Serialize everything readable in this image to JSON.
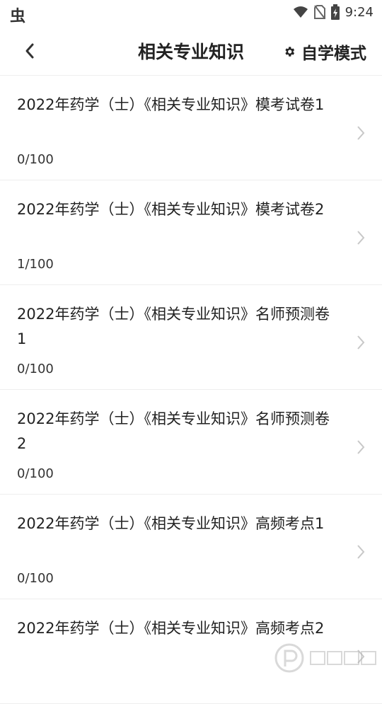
{
  "status_bar": {
    "app_icon": "虫",
    "time": "9:24"
  },
  "header": {
    "back_icon": "chevron-left-icon",
    "title": "相关专业知识",
    "mode_icon": "gear-icon",
    "mode_label": "自学模式"
  },
  "items": [
    {
      "title": "2022年药学（士）《相关专业知识》模考试卷1",
      "score": "0/100"
    },
    {
      "title": "2022年药学（士）《相关专业知识》模考试卷2",
      "score": "1/100"
    },
    {
      "title": "2022年药学（士）《相关专业知识》名师预测卷1",
      "score": "0/100"
    },
    {
      "title": "2022年药学（士）《相关专业知识》名师预测卷2",
      "score": "0/100"
    },
    {
      "title": "2022年药学（士）《相关专业知识》高频考点1",
      "score": "0/100"
    },
    {
      "title": "2022年药学（士）《相关专业知识》高频考点2",
      "score": ""
    }
  ],
  "colors": {
    "text": "#222222",
    "divider": "#eeeeee",
    "chevron": "#c8c8c8"
  }
}
